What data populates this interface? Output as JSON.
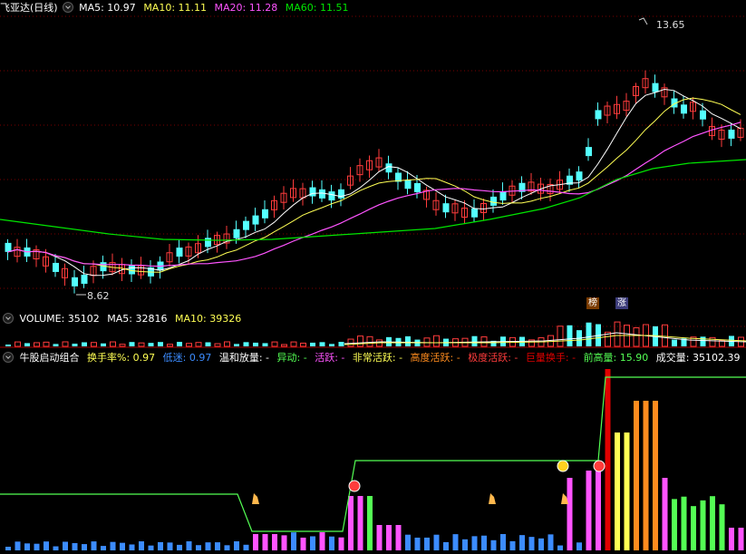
{
  "main_legend": {
    "title": "飞亚达(日线)",
    "ma5": "MA5: 10.97",
    "ma10": "MA10: 11.11",
    "ma20": "MA20: 11.28",
    "ma60": "MA60: 11.51"
  },
  "price_annotations": {
    "high": "13.65",
    "low": "8.62"
  },
  "tags": {
    "bang": "榜",
    "zhang": "涨"
  },
  "volume_legend": {
    "volume": "VOLUME: 35102",
    "ma5": "MA5: 32816",
    "ma10": "MA10: 39326"
  },
  "indicator_legend": {
    "name": "牛股启动组合",
    "turnover": "换手率%: 0.97",
    "low_label": "低迷: 0.97",
    "mild": "温和放量: -",
    "abnormal": "异动: -",
    "active": "活跃: -",
    "very_active": "非常活跃: -",
    "high_active": "高度活跃: -",
    "extreme_active": "极度活跃: -",
    "huge_turnover": "巨量换手: -",
    "prev_high_vol": "前高量: 15.90",
    "volume": "成交量: 35102.39",
    "extra": "成"
  },
  "colors": {
    "up": "#ff3c3c",
    "down": "#54ffff",
    "ma5": "#ffffff",
    "ma10": "#ffff54",
    "ma20": "#ff54ff",
    "ma60": "#00e600",
    "grid": "#7a0000",
    "sep": "#a00000"
  },
  "chart_data": [
    {
      "type": "candlestick",
      "title": "飞亚达(日线)",
      "annotations": [
        {
          "label": "13.65",
          "value": 13.65
        },
        {
          "label": "8.62",
          "value": 8.62
        }
      ],
      "series": [
        {
          "name": "MA5",
          "value": 10.97
        },
        {
          "name": "MA10",
          "value": 11.11
        },
        {
          "name": "MA20",
          "value": 11.28
        },
        {
          "name": "MA60",
          "value": 11.51
        }
      ]
    },
    {
      "type": "bar",
      "title": "VOLUME",
      "series": [
        {
          "name": "VOLUME",
          "value": 35102
        },
        {
          "name": "MA5",
          "value": 32816
        },
        {
          "name": "MA10",
          "value": 39326
        }
      ]
    },
    {
      "type": "bar",
      "title": "牛股启动组合",
      "series": [
        {
          "name": "换手率%",
          "value": 0.97
        },
        {
          "name": "前高量",
          "value": 15.9
        },
        {
          "name": "成交量",
          "value": 35102.39
        }
      ]
    }
  ]
}
